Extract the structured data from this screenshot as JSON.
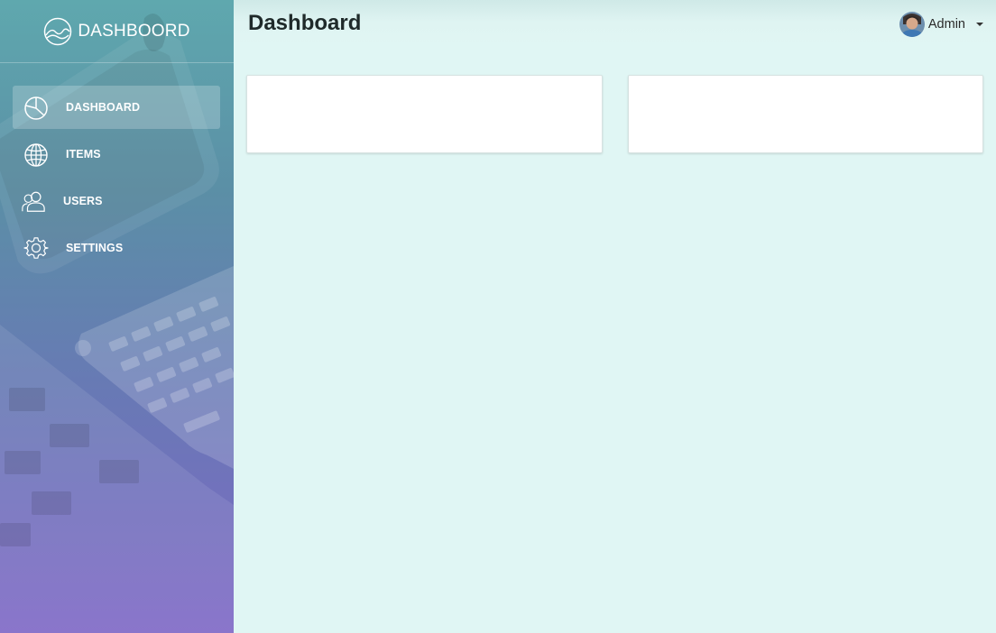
{
  "brand": {
    "name": "DASHBOORD",
    "logo_icon": "mountain-circle-logo"
  },
  "sidebar": {
    "items": [
      {
        "label": "DASHBOARD",
        "icon": "pie-chart-icon",
        "active": true
      },
      {
        "label": "ITEMS",
        "icon": "globe-icon",
        "active": false
      },
      {
        "label": "USERS",
        "icon": "users-icon",
        "active": false
      },
      {
        "label": "SETTINGS",
        "icon": "gear-icon",
        "active": false
      }
    ]
  },
  "header": {
    "title": "Dashboard",
    "user": {
      "name": "Admin",
      "avatar_icon": "avatar",
      "menu_icon": "caret-down-icon"
    }
  },
  "main": {
    "cards": [
      {
        "content": ""
      },
      {
        "content": ""
      }
    ]
  },
  "colors": {
    "content_background": "#e0f6f4",
    "sidebar_top": "#5fa8ae",
    "sidebar_bottom": "#7f68c6",
    "card_background": "#ffffff"
  }
}
